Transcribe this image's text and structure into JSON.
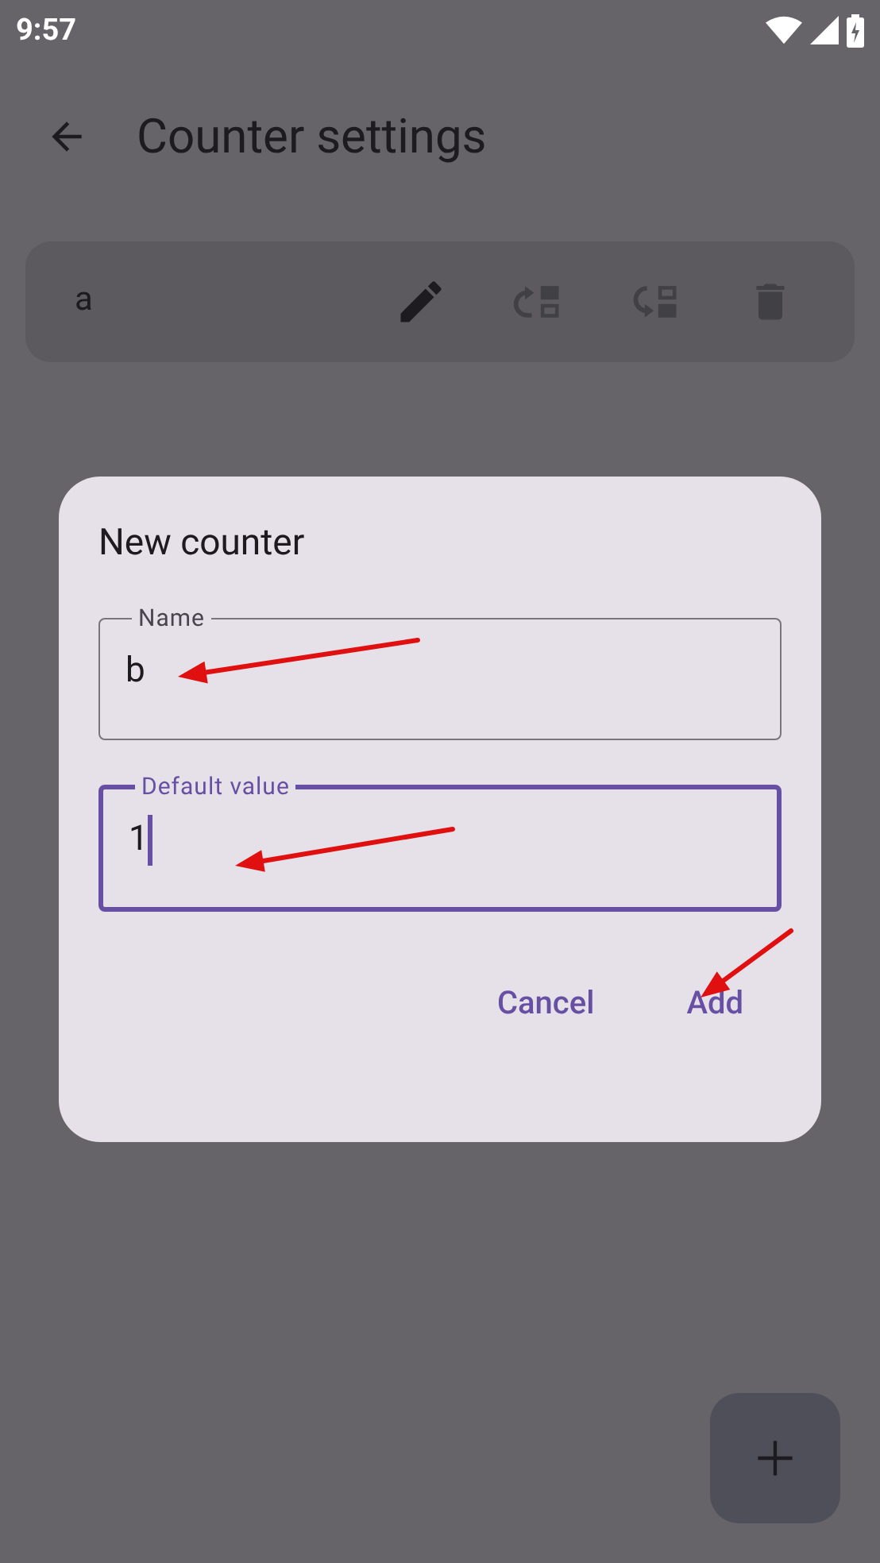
{
  "status_bar": {
    "time": "9:57"
  },
  "app_bar": {
    "title": "Counter settings"
  },
  "counters": [
    {
      "name": "a"
    }
  ],
  "dialog": {
    "title": "New counter",
    "fields": [
      {
        "label": "Name",
        "value": "b",
        "focused": false
      },
      {
        "label": "Default value",
        "value": "1",
        "focused": true
      }
    ],
    "buttons": [
      "Cancel",
      "Add"
    ]
  }
}
